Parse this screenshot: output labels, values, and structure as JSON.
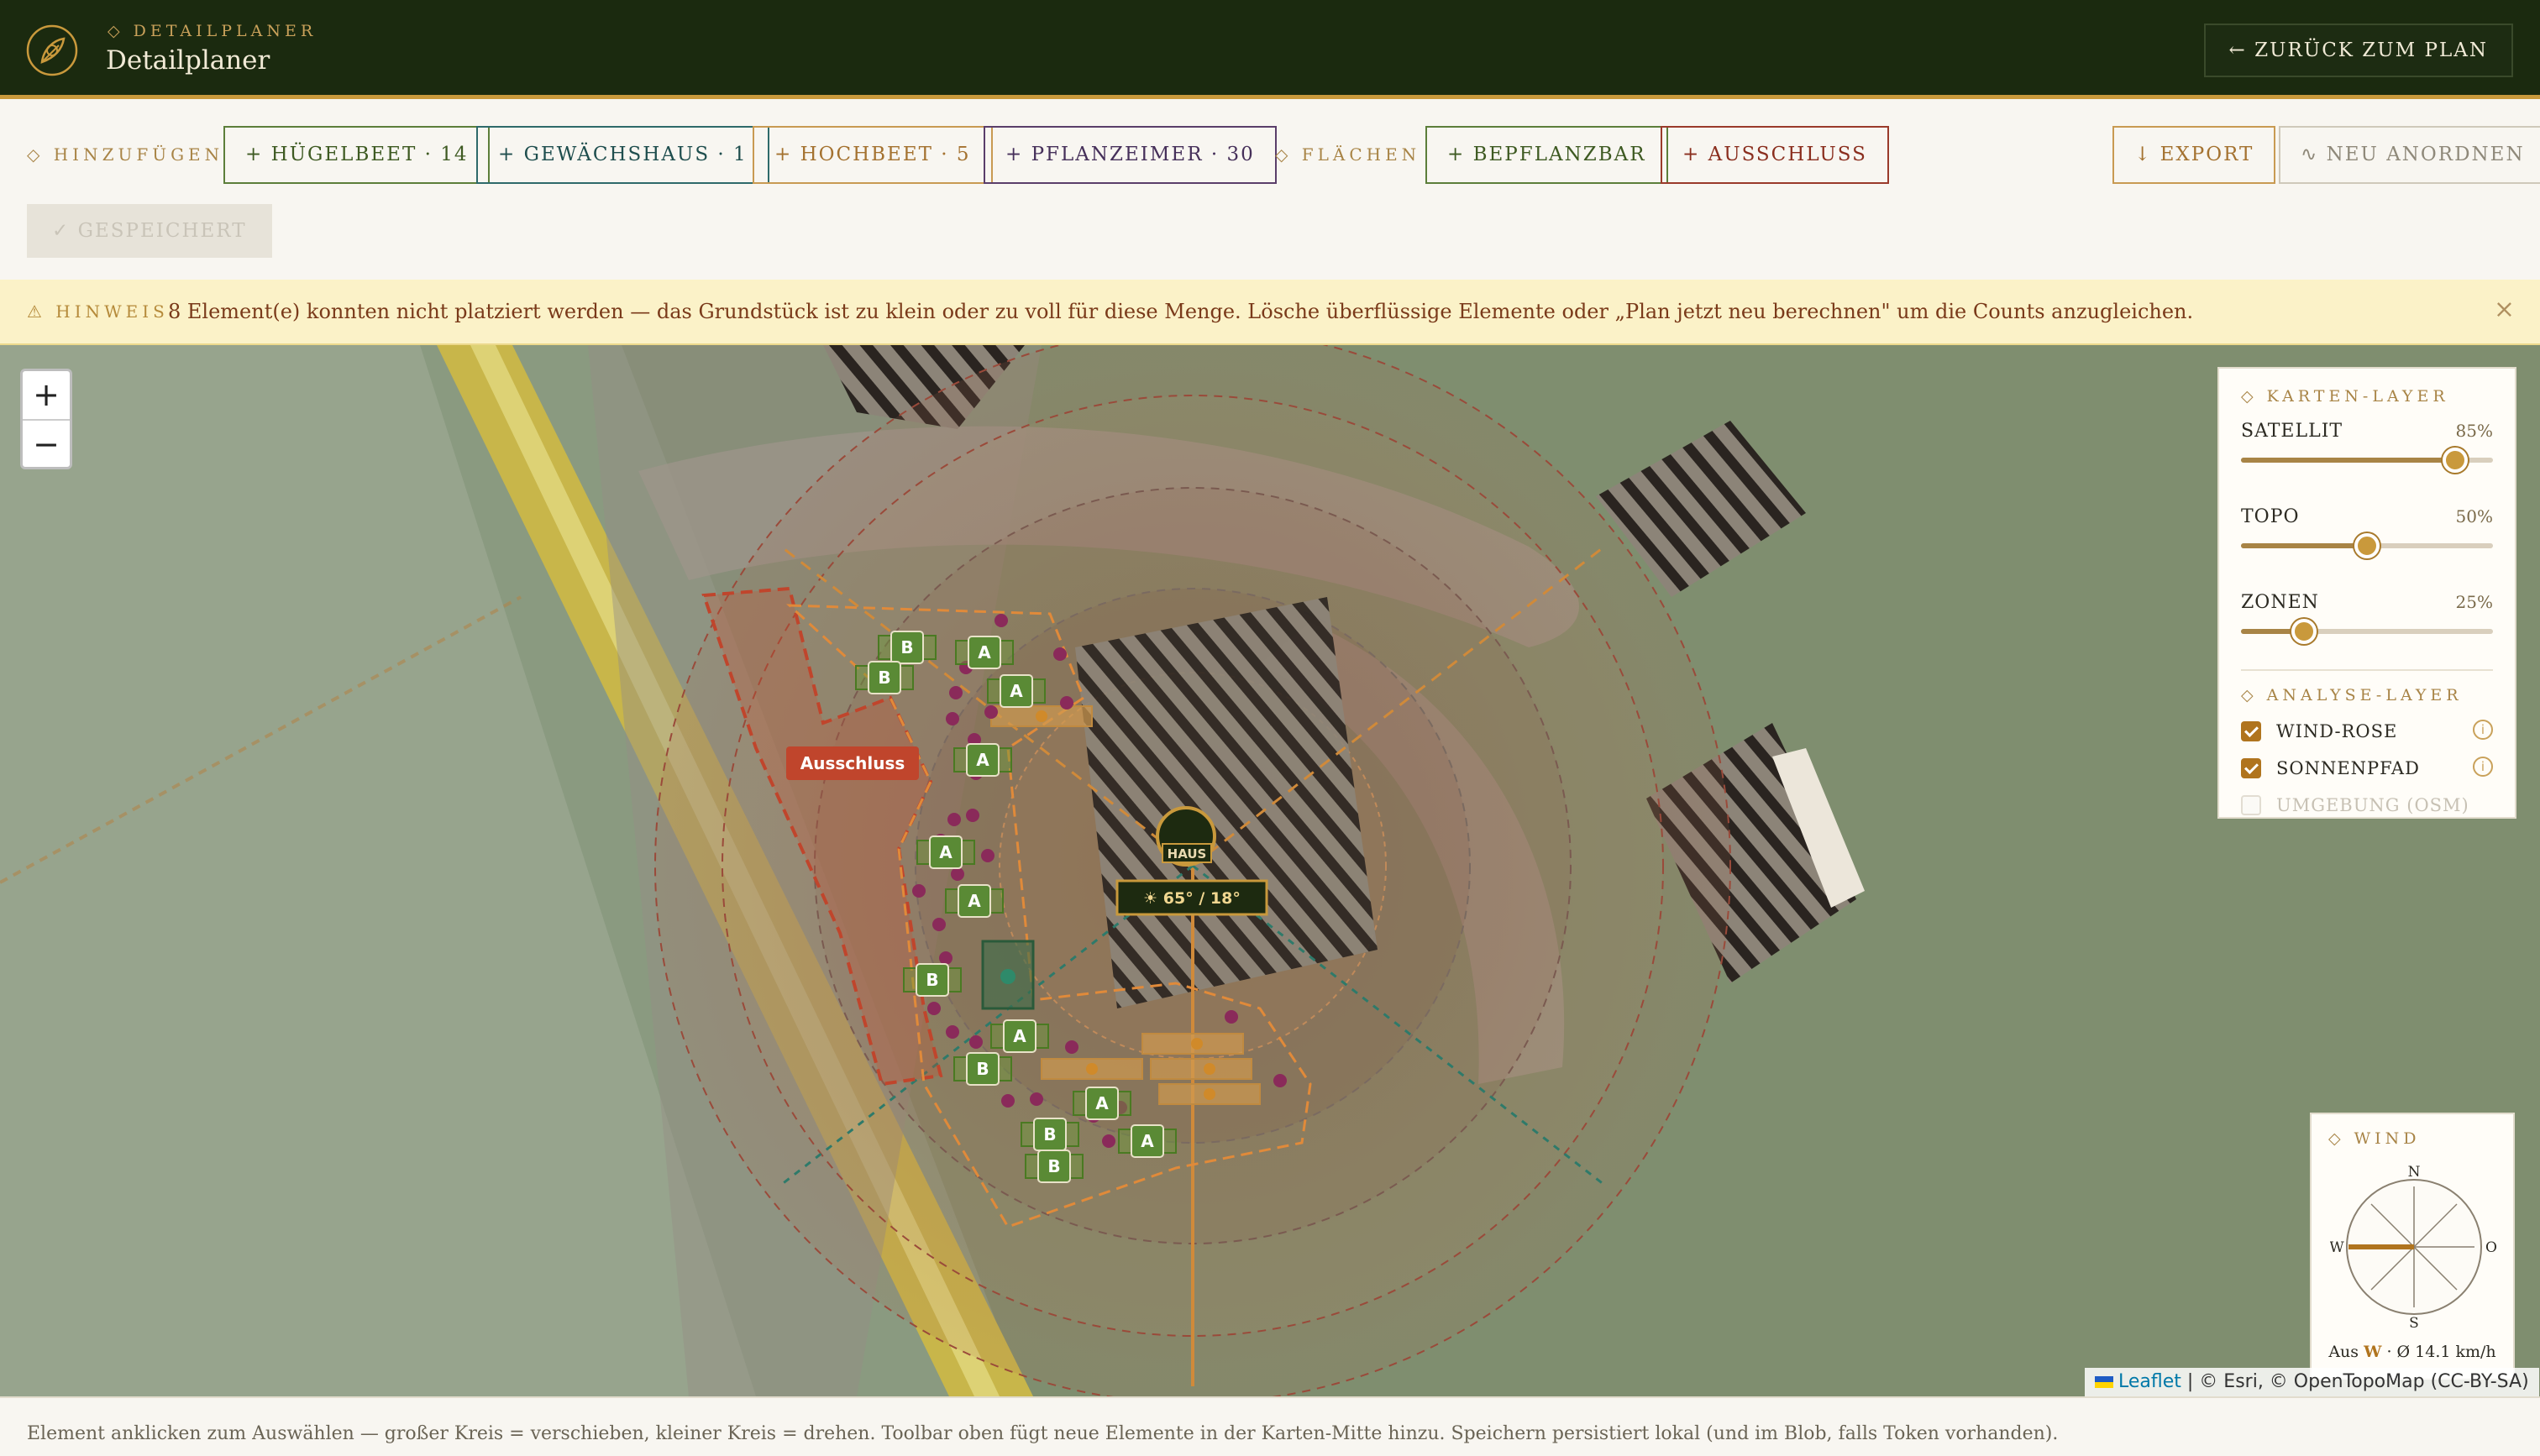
{
  "header": {
    "eyebrow": "◇ DETAILPLANER",
    "title": "Detailplaner",
    "back_label": "← ZURÜCK ZUM PLAN"
  },
  "toolbar": {
    "add_label": "◇ HINZUFÜGEN",
    "areas_label": "◇ FLÄCHEN",
    "buttons": {
      "huegelbeet": "+ HÜGELBEET · 14",
      "gewaechshaus": "+ GEWÄCHSHAUS · 1",
      "hochbeet": "+ HOCHBEET · 5",
      "pflanzeimer": "+ PFLANZEIMER · 30",
      "bepflanzbar": "+ BEPFLANZBAR",
      "ausschluss": "+ AUSSCHLUSS",
      "export": "↓ EXPORT",
      "rearrange": "∿ NEU ANORDNEN"
    },
    "saved_label": "✓ GESPEICHERT"
  },
  "notice": {
    "label": "⚠ HINWEIS",
    "text": "8 Element(e) konnten nicht platziert werden — das Grundstück ist zu klein oder zu voll für diese Menge. Lösche überflüssige Elemente oder „Plan jetzt neu berechnen\" um die Counts anzugleichen.",
    "close": "×"
  },
  "map": {
    "zoom_in": "+",
    "zoom_out": "−",
    "exclusion_label": "Ausschluss",
    "house_label": "HAUS",
    "sun_label": "☀ 65° / 18°",
    "bed_a": "A",
    "bed_b": "B",
    "attribution_leaflet": "Leaflet",
    "attribution_rest": " | © Esri, © OpenTopoMap (CC-BY-SA)"
  },
  "layers": {
    "map_heading": "◇ KARTEN-LAYER",
    "sliders": [
      {
        "name": "SATELLIT",
        "value_label": "85%",
        "value": 0.85
      },
      {
        "name": "TOPO",
        "value_label": "50%",
        "value": 0.5
      },
      {
        "name": "ZONEN",
        "value_label": "25%",
        "value": 0.25
      }
    ],
    "analysis_heading": "◇ ANALYSE-LAYER",
    "checks": [
      {
        "name": "WIND-ROSE",
        "checked": true
      },
      {
        "name": "SONNENPFAD",
        "checked": true
      },
      {
        "name": "UMGEBUNG (OSM)",
        "checked": false
      }
    ],
    "info_glyph": "i"
  },
  "wind": {
    "heading": "◇ WIND",
    "n": "N",
    "s": "S",
    "w": "W",
    "o": "O",
    "caption_pre": "Aus ",
    "caption_dir": "W",
    "caption_post": " · Ø 14.1 km/h"
  },
  "footer": {
    "text": "Element anklicken zum Auswählen — großer Kreis = verschieben, kleiner Kreis = drehen. Toolbar oben fügt neue Elemente in der Karten-Mitte hinzu. Speichern persistiert lokal (und im Blob, falls Token vorhanden)."
  },
  "colors": {
    "header_bg": "#1b2a0f",
    "accent": "#c9993c",
    "bed_green": "#5a8a35",
    "exclusion_red": "#c0452c",
    "notice_bg": "#fbf2c8"
  }
}
